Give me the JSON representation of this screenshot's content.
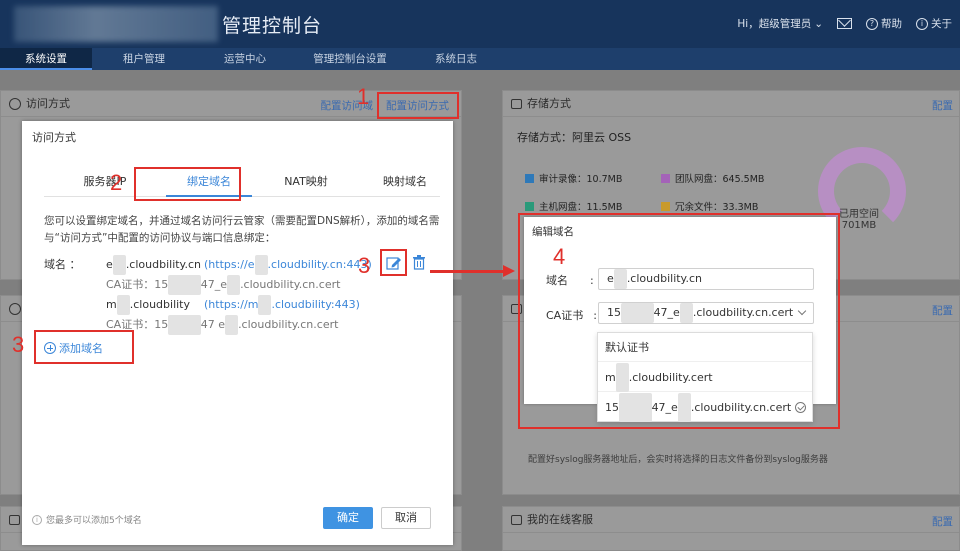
{
  "header": {
    "title": "管理控制台",
    "user_greeting": "Hi，超级管理员",
    "help_label": "帮助",
    "about_label": "关于"
  },
  "nav": {
    "items": [
      {
        "label": "系统设置"
      },
      {
        "label": "租户管理"
      },
      {
        "label": "运营中心"
      },
      {
        "label": "管理控制台设置"
      },
      {
        "label": "系统日志"
      }
    ]
  },
  "background": {
    "access_panel_title": "访问方式",
    "access_panel_links": [
      "配置访问域",
      "配置访问方式"
    ],
    "storage_panel_title": "存储方式",
    "storage_panel_link": "配置",
    "storage_type": "存储方式：阿里云 OSS",
    "storage_legend": [
      {
        "label": "审计录像：10.7MB",
        "color": "#2e79b9"
      },
      {
        "label": "团队网盘：645.5MB",
        "color": "#a463b8"
      },
      {
        "label": "主机网盘：11.5MB",
        "color": "#2a9a7a"
      },
      {
        "label": "冗余文件：33.3MB",
        "color": "#c99a2b"
      }
    ],
    "used_space_label": "已用空间",
    "used_space_value": "701MB",
    "panel2_link": "配置",
    "syslog_note": "配置好syslog服务器地址后，会实时将选择的日志文件备份到syslog服务器",
    "online_service_title": "我的在线客服",
    "online_service_link": "配置"
  },
  "dialog": {
    "title": "访问方式",
    "tabs": [
      {
        "label": "服务器IP"
      },
      {
        "label": "绑定域名"
      },
      {
        "label": "NAT映射"
      },
      {
        "label": "映射域名"
      }
    ],
    "description": "您可以设置绑定域名，并通过域名访问行云管家（需要配置DNS解析），添加的域名需与“访问方式”中配置的访问协议与端口信息绑定：",
    "domain_label": "域名 ：",
    "domains": [
      {
        "name_prefix": "e",
        "name_suffix": ".cloudbility.cn",
        "url_prefix": "(https://e",
        "url_suffix": ".cloudbility.cn:443)",
        "cert_prefix": "CA证书：15",
        "cert_middle": "47_e",
        "cert_suffix": ".cloudbility.cn.cert"
      },
      {
        "name_prefix": "m",
        "name_suffix": ".cloudbility",
        "url_prefix": "(https://m",
        "url_suffix": ".cloudbility:443)",
        "cert_prefix": "CA证书：15",
        "cert_middle": "47 e",
        "cert_suffix": ".cloudbility.cn.cert"
      }
    ],
    "add_domain_label": "添加域名",
    "footer_hint": "您最多可以添加5个域名",
    "confirm_label": "确定",
    "cancel_label": "取消"
  },
  "edit_popup": {
    "title": "编辑域名",
    "domain_label": "域名",
    "domain_value_prefix": "e",
    "domain_value_suffix": ".cloudbility.cn",
    "cert_label": "CA证书",
    "cert_value_prefix": "15",
    "cert_value_suffix": "47_e",
    "cert_value_tail": ".cloudbility.cn.cert",
    "options": [
      {
        "label": "默认证书"
      },
      {
        "prefix": "m",
        "suffix": ".cloudbility.cert"
      },
      {
        "prefix": "15",
        "middle": "47_e",
        "suffix": ".cloudbility.cn.cert"
      }
    ]
  },
  "annotations": {
    "step1": "1",
    "step2": "2",
    "step3a": "3",
    "step3b": "3",
    "step4": "4",
    "color": "#e0302b"
  }
}
